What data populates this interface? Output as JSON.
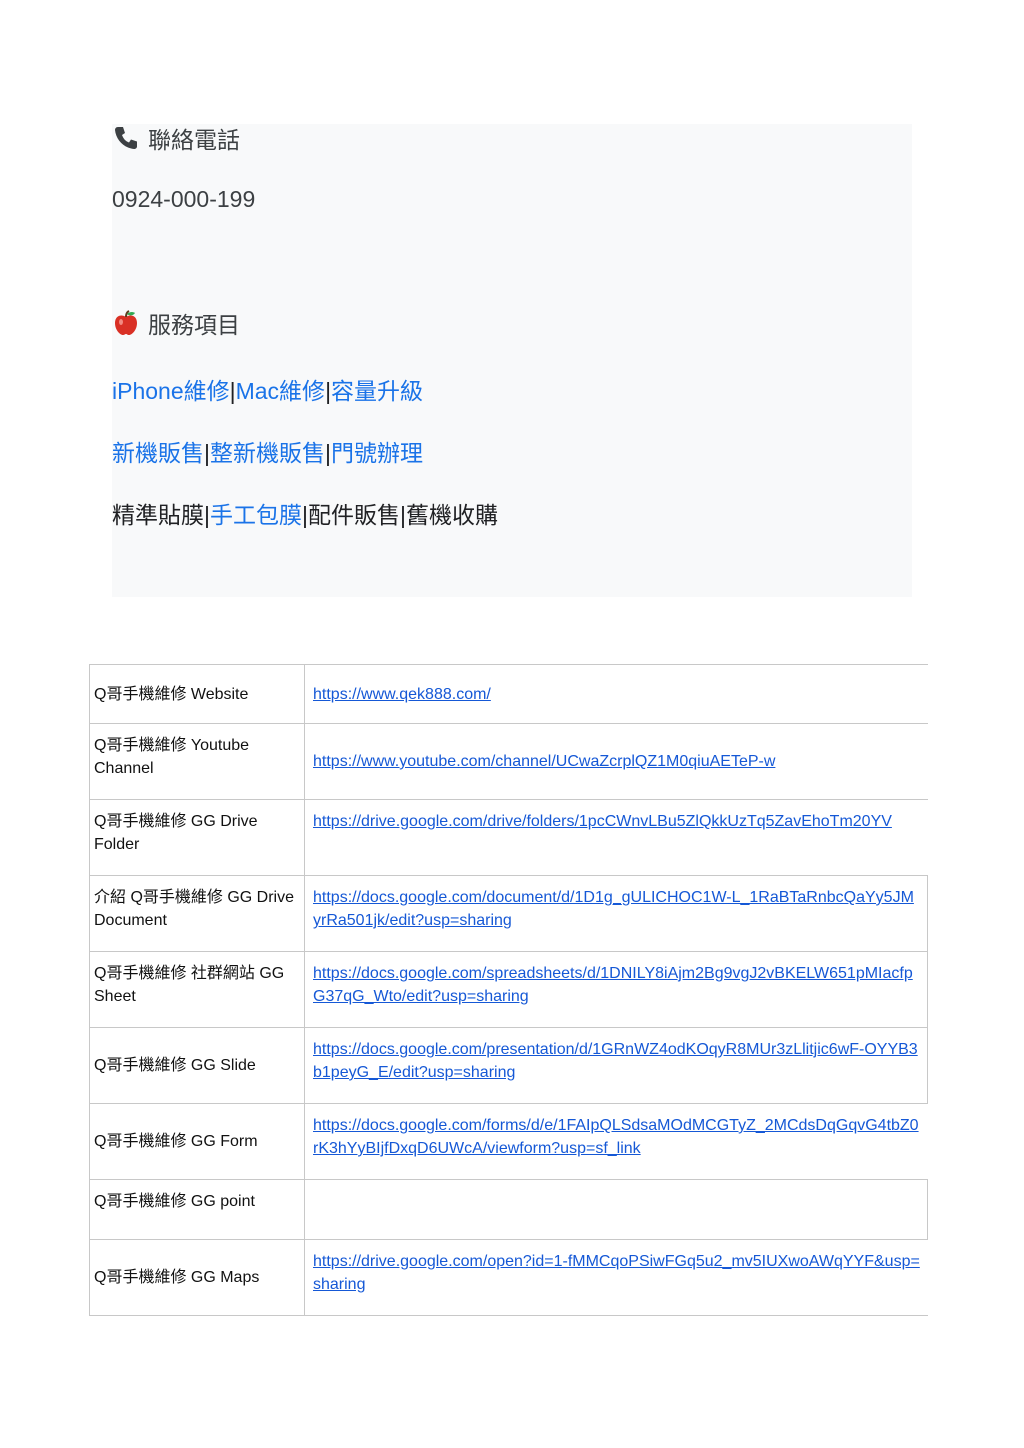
{
  "contact": {
    "icon": "telephone-icon",
    "heading": "聯絡電話",
    "phone": "0924-000-199"
  },
  "services": {
    "icon": "red-apple-icon",
    "heading": "服務項目",
    "line1": {
      "a": "iPhone維修",
      "b": "Mac維修",
      "c": "容量升級"
    },
    "line2": {
      "a": "新機販售",
      "b": "整新機販售",
      "c": "門號辦理"
    },
    "line3": {
      "a": "精準貼膜",
      "b": "手工包膜",
      "c": "配件販售",
      "d": "舊機收購"
    },
    "separator": "|"
  },
  "links_table": {
    "rows": [
      {
        "label": "Q哥手機維修 Website",
        "url": "https://www.qek888.com/"
      },
      {
        "label": "Q哥手機維修 Youtube Channel",
        "url": "https://www.youtube.com/channel/UCwaZcrplQZ1M0qiuAETeP-w"
      },
      {
        "label": "Q哥手機維修 GG Drive Folder",
        "url": "https://drive.google.com/drive/folders/1pcCWnvLBu5ZlQkkUzTq5ZavEhoTm20YV"
      },
      {
        "label": "介紹 Q哥手機維修 GG Drive Document",
        "url": "https://docs.google.com/document/d/1D1g_gULICHOC1W-L_1RaBTaRnbcQaYy5JMyrRa501jk/edit?usp=sharing"
      },
      {
        "label": "Q哥手機維修 社群網站 GG Sheet",
        "url": "https://docs.google.com/spreadsheets/d/1DNILY8iAjm2Bg9vgJ2vBKELW651pMIacfpG37qG_Wto/edit?usp=sharing"
      },
      {
        "label": "Q哥手機維修 GG Slide",
        "url": "https://docs.google.com/presentation/d/1GRnWZ4odKOqyR8MUr3zLlitjic6wF-OYYB3b1peyG_E/edit?usp=sharing"
      },
      {
        "label": "Q哥手機維修 GG Form",
        "url": "https://docs.google.com/forms/d/e/1FAIpQLSdsaMOdMCGTyZ_2MCdsDqGqvG4tbZ0rK3hYyBIjfDxqD6UWcA/viewform?usp=sf_link"
      },
      {
        "label": "Q哥手機維修 GG point",
        "url": ""
      },
      {
        "label": "Q哥手機維修 GG Maps",
        "url": "https://drive.google.com/open?id=1-fMMCqoPSiwFGq5u2_mv5IUXwoAWqYYF&usp=sharing"
      }
    ]
  }
}
